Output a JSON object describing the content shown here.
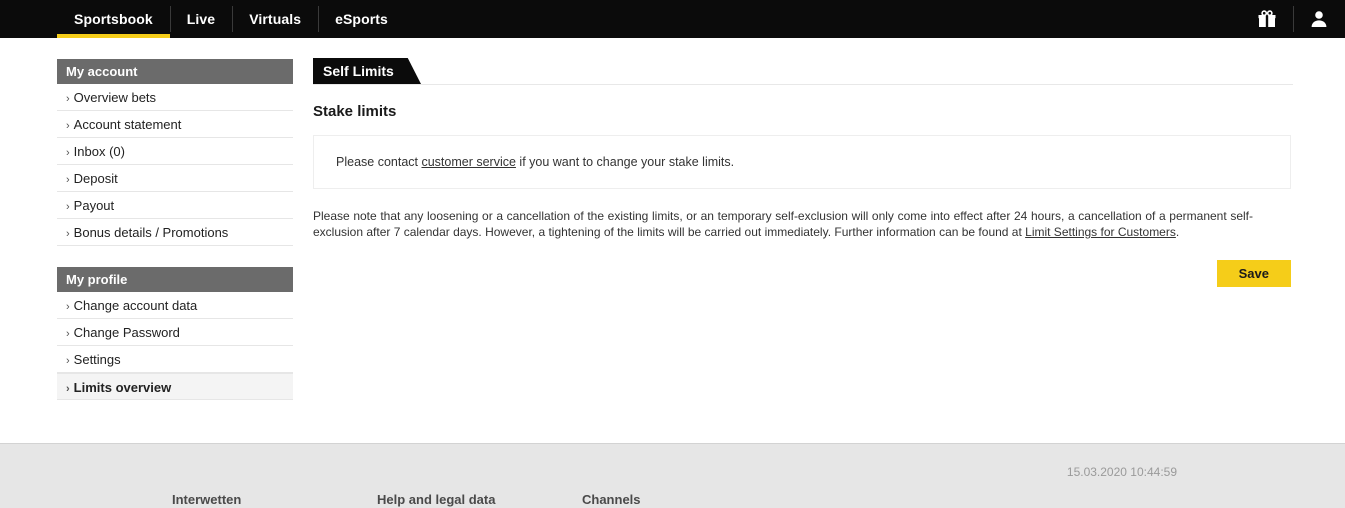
{
  "topnav": {
    "items": [
      {
        "label": "Sportsbook",
        "active": true
      },
      {
        "label": "Live",
        "active": false
      },
      {
        "label": "Virtuals",
        "active": false
      },
      {
        "label": "eSports",
        "active": false
      }
    ],
    "icons": [
      {
        "name": "gift-icon",
        "label": "Promotions"
      },
      {
        "name": "user-icon",
        "label": "My account"
      }
    ],
    "background": "#0b0b0b",
    "accent": "#f5cd19"
  },
  "sidebar": {
    "groups": [
      {
        "title": "My account",
        "items": [
          {
            "label": "Overview bets",
            "active": false
          },
          {
            "label": "Account statement",
            "active": false
          },
          {
            "label": "Inbox (0)",
            "active": false
          },
          {
            "label": "Deposit",
            "active": false
          },
          {
            "label": "Payout",
            "active": false
          },
          {
            "label": "Bonus details / Promotions",
            "active": false
          }
        ]
      },
      {
        "title": "My profile",
        "items": [
          {
            "label": "Change account data",
            "active": false
          },
          {
            "label": "Change Password",
            "active": false
          },
          {
            "label": "Settings",
            "active": false
          },
          {
            "label": "Limits overview",
            "active": true
          }
        ]
      }
    ],
    "chevron": "›",
    "header_background": "#6b6b6b"
  },
  "content": {
    "tab_label": "Self Limits",
    "section_title": "Stake limits",
    "infobox": {
      "text_before": "Please contact ",
      "link": "customer service",
      "text_after": " if you want to change your stake limits."
    },
    "note": {
      "text_before": "Please note that any loosening or a cancellation of the existing limits, or an temporary self-exclusion will only come into effect after 24 hours, a cancellation of a permanent self-exclusion after 7 calendar days. However, a tightening of the limits will be carried out immediately. Further information can be found at ",
      "link": "Limit Settings for Customers",
      "text_after": "."
    },
    "save_label": "Save",
    "save_color": "#f5cd19"
  },
  "footer": {
    "timestamp": "15.03.2020 10:44:59",
    "columns": [
      {
        "title": "Interwetten"
      },
      {
        "title": "Help and legal data"
      },
      {
        "title": "Channels"
      }
    ],
    "background": "#e6e6e6"
  }
}
